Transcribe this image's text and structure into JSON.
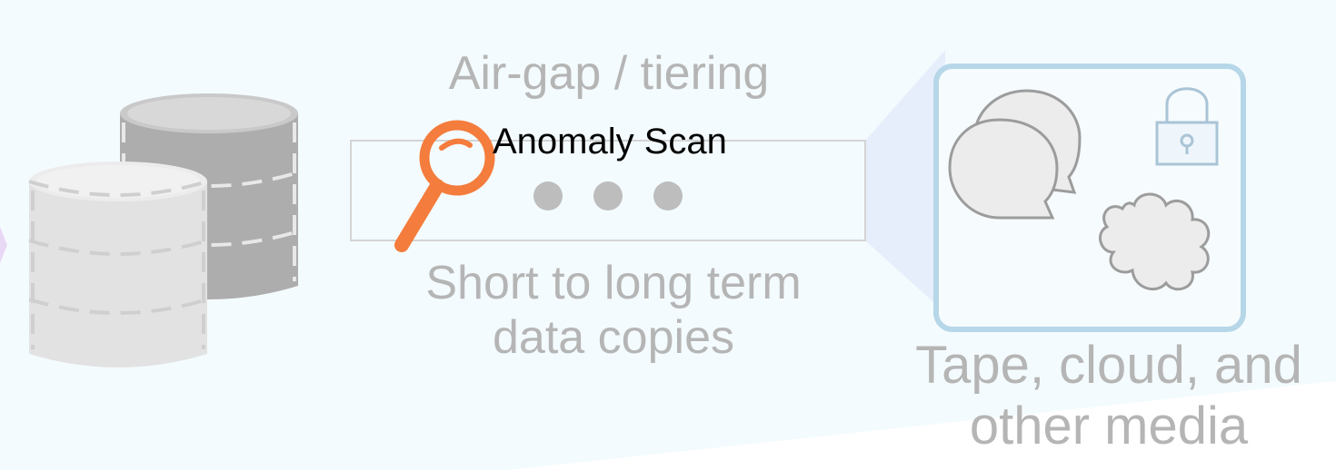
{
  "labels": {
    "airgap": "Air-gap / tiering",
    "anomaly_scan": "Anomaly Scan",
    "copies_line1": "Short to long term",
    "copies_line2": "data copies",
    "media_line1": "Tape, cloud, and",
    "media_line2": "other media"
  },
  "icons": {
    "databases": "database-stack-icon",
    "magnifier": "magnifier-icon",
    "dots": "ellipsis-icon",
    "chat": "chat-bubbles-icon",
    "lock": "padlock-icon",
    "cloud": "cloud-icon"
  },
  "colors": {
    "background": "#f4fbfe",
    "accent_orange": "#f47c3c",
    "media_frame": "#b6d7e8",
    "gray_text": "#b5b5b5",
    "light_db": "#e2e2e2",
    "dark_db": "#adadad"
  }
}
